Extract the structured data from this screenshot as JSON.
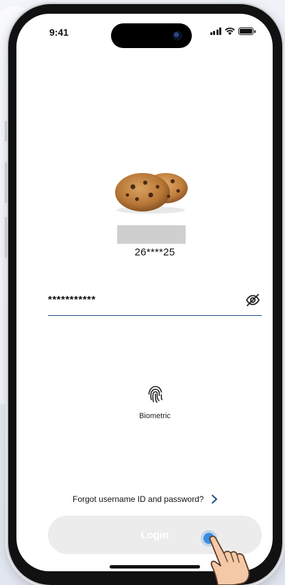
{
  "status_bar": {
    "time": "9:41",
    "icons": [
      "signal-icon",
      "wifi-icon",
      "battery-icon"
    ]
  },
  "profile": {
    "avatar_icon": "cookies-image",
    "masked_id": "26****25"
  },
  "password": {
    "value": "***********",
    "toggle_icon": "eye-off-icon"
  },
  "biometric": {
    "icon": "fingerprint-icon",
    "label": "Biometric"
  },
  "forgot": {
    "label": "Forgot username ID and password?",
    "icon": "chevron-right-icon"
  },
  "login": {
    "label": "Login",
    "state": "disabled"
  },
  "colors": {
    "accent": "#1f4e8c",
    "button_bg": "#ececec",
    "tap_indicator": "#3a8ee0"
  }
}
